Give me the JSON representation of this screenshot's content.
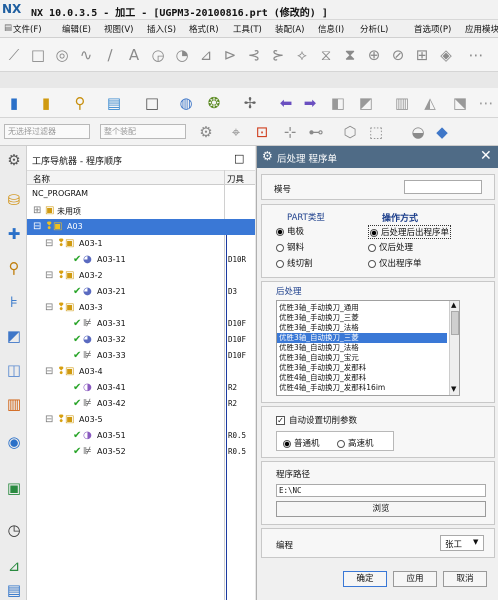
{
  "window": {
    "logo": "NX",
    "title": "NX 10.0.3.5 - 加工 - [UGPM3-20100816.prt (修改的) ]"
  },
  "menu": [
    "文件(F)",
    "编辑(E)",
    "视图(V)",
    "插入(S)",
    "格式(R)",
    "工具(T)",
    "装配(A)",
    "信息(I)",
    "分析(L)",
    "首选项(P)",
    "应用模块"
  ],
  "filters": {
    "type": "无选择过滤器",
    "scope": "整个装配"
  },
  "navigator": {
    "title": "工序导航器 - 程序顺序",
    "col_name": "名称",
    "col_tool": "刀具",
    "rows": [
      {
        "label": "NC_PROGRAM",
        "tool": ""
      },
      {
        "label": "未用项",
        "tool": ""
      },
      {
        "label": "A03",
        "tool": ""
      },
      {
        "label": "A03-1",
        "tool": ""
      },
      {
        "label": "A03-11",
        "tool": "D10R"
      },
      {
        "label": "A03-2",
        "tool": ""
      },
      {
        "label": "A03-21",
        "tool": "D3"
      },
      {
        "label": "A03-3",
        "tool": ""
      },
      {
        "label": "A03-31",
        "tool": "D10F"
      },
      {
        "label": "A03-32",
        "tool": "D10F"
      },
      {
        "label": "A03-33",
        "tool": "D10F"
      },
      {
        "label": "A03-4",
        "tool": ""
      },
      {
        "label": "A03-41",
        "tool": "R2"
      },
      {
        "label": "A03-42",
        "tool": "R2"
      },
      {
        "label": "A03-5",
        "tool": ""
      },
      {
        "label": "A03-51",
        "tool": "R0.5"
      },
      {
        "label": "A03-52",
        "tool": "R0.5"
      }
    ]
  },
  "dialog": {
    "title": "后处理 程序单",
    "model_label": "模号",
    "model_value": "",
    "part_type": {
      "title": "PART类型",
      "options": [
        "电极",
        "钢料",
        "线切割"
      ],
      "selected": 0
    },
    "operation": {
      "title": "操作方式",
      "options": [
        "后处理后出程序单",
        "仅后处理",
        "仅出程序单"
      ],
      "selected": 0
    },
    "post_label": "后处理",
    "post_items": [
      "优胜3轴_手动换刀_通用",
      "优胜3轴_手动换刀_三菱",
      "优胜3轴_手动换刀_法格",
      "优胜3轴_自动换刀_三菱",
      "优胜3轴_自动换刀_法格",
      "优胜3轴_自动换刀_宝元",
      "优胜3轴_手动换刀_发那科",
      "优胜4轴_自动换刀_发那科",
      "优胜4轴_手动换刀_发那科16im"
    ],
    "post_selected": 3,
    "auto_cut_label": "自动设置切削参数",
    "machine_options": [
      "普通机",
      "高速机"
    ],
    "machine_selected": 0,
    "path_label": "程序路径",
    "path_value": "E:\\NC",
    "browse_label": "浏览",
    "programmer_label": "编程",
    "programmer_value": "张工",
    "ok_label": "确定",
    "apply_label": "应用",
    "cancel_label": "取消"
  },
  "colors": {
    "selection": "#3a78d6",
    "dialog_header": "#4f6b86",
    "check_green": "#2aa52a"
  }
}
